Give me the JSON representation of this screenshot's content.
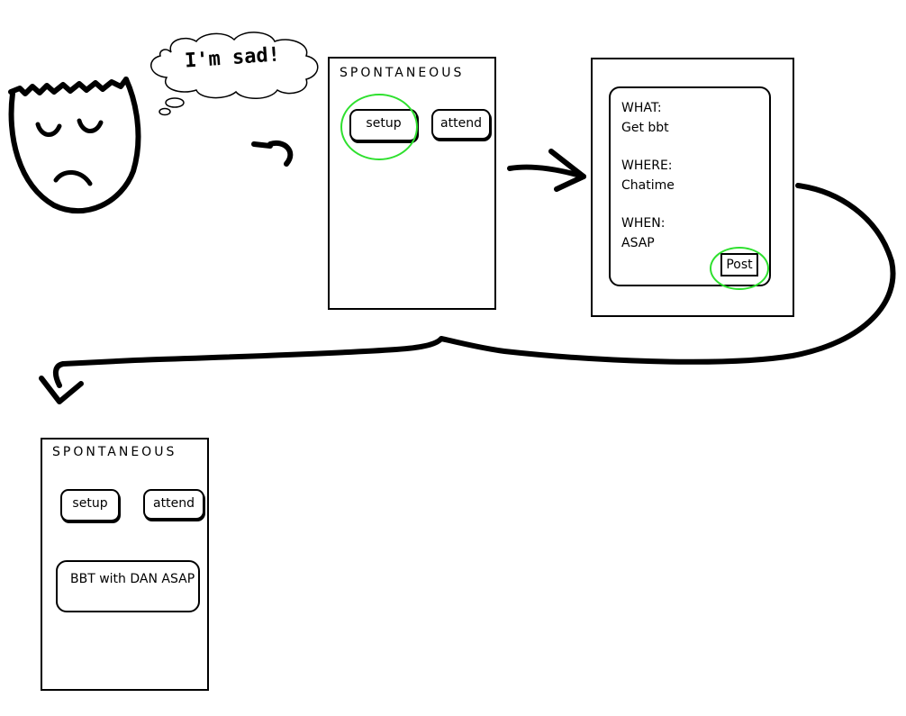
{
  "thought_bubble": {
    "text": "I'm sad!"
  },
  "screen_home": {
    "title": "SPONTANEOUS",
    "setup_label": "setup",
    "attend_label": "attend"
  },
  "screen_form": {
    "what_label": "WHAT:",
    "what_value": "Get bbt",
    "where_label": "WHERE:",
    "where_value": "Chatime",
    "when_label": "WHEN:",
    "when_value": "ASAP",
    "post_label": "Post"
  },
  "screen_result": {
    "title": "SPONTANEOUS",
    "setup_label": "setup",
    "attend_label": "attend",
    "event_text": "BBT with DAN ASAP"
  },
  "colors": {
    "highlight": "#2ee02e",
    "ink": "#000000"
  }
}
